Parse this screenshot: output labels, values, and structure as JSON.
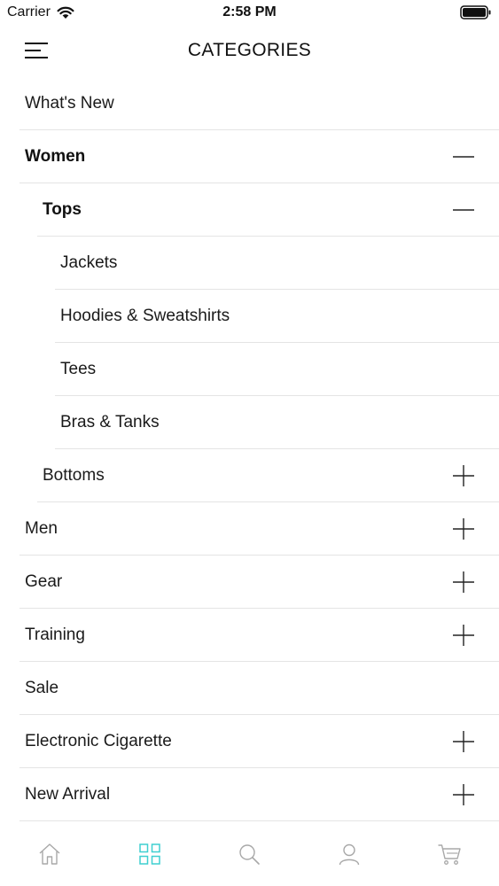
{
  "status_bar": {
    "carrier": "Carrier",
    "time": "2:58 PM"
  },
  "nav": {
    "title": "CATEGORIES"
  },
  "categories": [
    {
      "label": "What's New",
      "level": 0,
      "bold": false,
      "icon": "none"
    },
    {
      "label": "Women",
      "level": 0,
      "bold": true,
      "icon": "minus-icon"
    },
    {
      "label": "Tops",
      "level": 1,
      "bold": true,
      "icon": "minus-icon"
    },
    {
      "label": "Jackets",
      "level": 2,
      "bold": false,
      "icon": "none"
    },
    {
      "label": "Hoodies & Sweatshirts",
      "level": 2,
      "bold": false,
      "icon": "none"
    },
    {
      "label": "Tees",
      "level": 2,
      "bold": false,
      "icon": "none"
    },
    {
      "label": "Bras & Tanks",
      "level": 2,
      "bold": false,
      "icon": "none"
    },
    {
      "label": "Bottoms",
      "level": 1,
      "bold": false,
      "icon": "plus-icon"
    },
    {
      "label": "Men",
      "level": 0,
      "bold": false,
      "icon": "plus-icon"
    },
    {
      "label": "Gear",
      "level": 0,
      "bold": false,
      "icon": "plus-icon"
    },
    {
      "label": "Training",
      "level": 0,
      "bold": false,
      "icon": "plus-icon"
    },
    {
      "label": "Sale",
      "level": 0,
      "bold": false,
      "icon": "none"
    },
    {
      "label": "Electronic Cigarette",
      "level": 0,
      "bold": false,
      "icon": "plus-icon"
    },
    {
      "label": "New Arrival",
      "level": 0,
      "bold": false,
      "icon": "plus-icon"
    }
  ],
  "tab_bar": {
    "tabs": [
      {
        "icon": "home-icon",
        "active": false
      },
      {
        "icon": "categories-grid-icon",
        "active": true
      },
      {
        "icon": "search-icon",
        "active": false
      },
      {
        "icon": "user-icon",
        "active": false
      },
      {
        "icon": "cart-icon",
        "active": false
      }
    ]
  },
  "colors": {
    "text": "#111111",
    "divider": "#e4e4e4",
    "tab_inactive": "#a8a8a8",
    "tab_active": "#3ecfd0"
  }
}
